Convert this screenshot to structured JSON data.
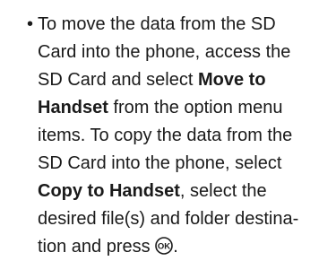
{
  "instruction": {
    "bullet": "•",
    "lines": [
      [
        "To move the data from the SD"
      ],
      [
        "Card into the phone, access the"
      ],
      [
        "SD Card and select ",
        {
          "bold": "Move to"
        }
      ],
      [
        {
          "bold": "Handset"
        },
        " from the option menu"
      ],
      [
        "items. To copy the data from the"
      ],
      [
        "SD Card into the phone, select"
      ],
      [
        {
          "bold": "Copy to Handset"
        },
        ", select the"
      ],
      [
        "desired file(s) and folder destina-"
      ],
      [
        "tion and press ",
        {
          "icon": "ok-key-icon"
        },
        "."
      ]
    ],
    "ok_key_label": "OK"
  }
}
